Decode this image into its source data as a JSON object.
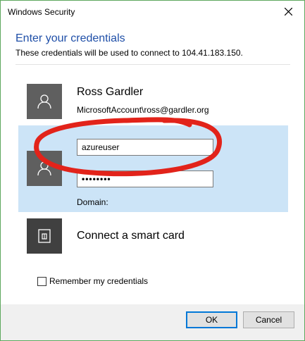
{
  "window": {
    "title": "Windows Security"
  },
  "dialog": {
    "heading": "Enter your credentials",
    "subheading": "These credentials will be used to connect to 104.41.183.150."
  },
  "accounts": {
    "primary": {
      "name": "Ross Gardler",
      "id": "MicrosoftAccount\\ross@gardler.org",
      "icon": "user-icon"
    },
    "selected": {
      "icon": "user-icon",
      "username_value": "azureuser",
      "password_mask": "••••••••",
      "domain_label": "Domain:"
    },
    "smartcard": {
      "label": "Connect a smart card",
      "icon": "smart-card-icon"
    }
  },
  "remember": {
    "label": "Remember my credentials",
    "checked": false
  },
  "buttons": {
    "ok": "OK",
    "cancel": "Cancel"
  },
  "colors": {
    "heading": "#1f4fa8",
    "selected_bg": "#cce4f7",
    "annotation": "#e2231a",
    "focus_border": "#0078d7"
  }
}
